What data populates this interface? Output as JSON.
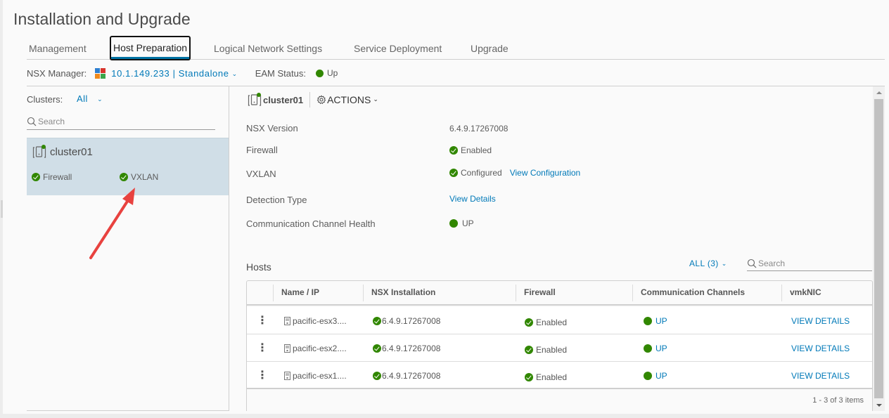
{
  "page": {
    "title": "Installation and Upgrade"
  },
  "tabs": [
    {
      "label": "Management",
      "active": false
    },
    {
      "label": "Host Preparation",
      "active": true
    },
    {
      "label": "Logical Network Settings",
      "active": false
    },
    {
      "label": "Service Deployment",
      "active": false
    },
    {
      "label": "Upgrade",
      "active": false
    }
  ],
  "manager_bar": {
    "label": "NSX Manager:",
    "value": "10.1.149.233 | Standalone",
    "icon": "nsx-manager-icon",
    "eam_label": "EAM Status:",
    "eam_value": "Up"
  },
  "clusters_panel": {
    "label": "Clusters:",
    "filter": "All",
    "search_placeholder": "Search",
    "clusters": [
      {
        "name": "cluster01",
        "statuses": [
          {
            "label": "Firewall",
            "icon": "check-circle-icon"
          },
          {
            "label": "VXLAN",
            "icon": "check-circle-icon"
          }
        ]
      }
    ]
  },
  "detail": {
    "cluster_name": "cluster01",
    "actions_label": "ACTIONS",
    "rows": [
      {
        "label": "NSX Version",
        "value": "6.4.9.17267008"
      },
      {
        "label": "Firewall",
        "value": "Enabled"
      },
      {
        "label": "VXLAN",
        "value": "Configured",
        "link": "View Configuration"
      },
      {
        "label": "Detection Type",
        "link": "View Details"
      },
      {
        "label": "Communication Channel Health",
        "value": "UP"
      }
    ]
  },
  "hosts": {
    "title": "Hosts",
    "filter": "ALL (3)",
    "search_placeholder": "Search",
    "columns": [
      "Name / IP",
      "NSX Installation",
      "Firewall",
      "Communication Channels",
      "vmkNIC"
    ],
    "rows": [
      {
        "name": "pacific-esx3....",
        "nsx": "6.4.9.17267008",
        "firewall": "Enabled",
        "comm": "UP",
        "vmknic": "VIEW DETAILS"
      },
      {
        "name": "pacific-esx2....",
        "nsx": "6.4.9.17267008",
        "firewall": "Enabled",
        "comm": "UP",
        "vmknic": "VIEW DETAILS"
      },
      {
        "name": "pacific-esx1....",
        "nsx": "6.4.9.17267008",
        "firewall": "Enabled",
        "comm": "UP",
        "vmknic": "VIEW DETAILS"
      }
    ],
    "footer": "1 - 3 of 3 items"
  },
  "colors": {
    "accent": "#0079b8",
    "status_ok": "#318700",
    "selected_bg": "#d0dee7",
    "annotation_arrow": "#e8423f"
  }
}
